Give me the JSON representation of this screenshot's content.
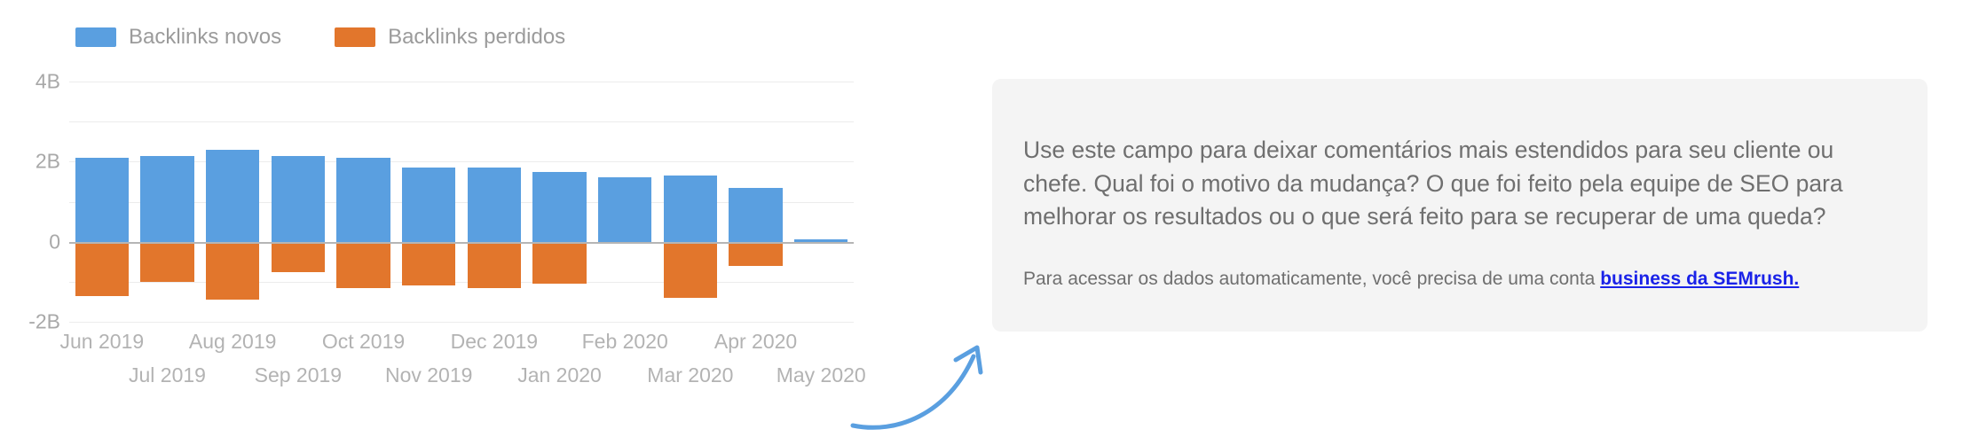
{
  "legend": {
    "items": [
      {
        "label": "Backlinks novos",
        "color": "#5a9fe0"
      },
      {
        "label": "Backlinks perdidos",
        "color": "#e2762c"
      }
    ]
  },
  "chart_data": {
    "type": "bar",
    "title": "",
    "xlabel": "",
    "ylabel": "",
    "ylim": [
      -2,
      4
    ],
    "unit": "B",
    "grid": true,
    "legend_position": "top-left",
    "gridline_values": [
      4,
      3,
      2,
      1,
      0,
      -1,
      -2
    ],
    "ytick_labels": [
      "4B",
      "2B",
      "0",
      "-2B"
    ],
    "ytick_values": [
      4,
      2,
      0,
      -2
    ],
    "categories": [
      "Jun 2019",
      "Jul 2019",
      "Aug 2019",
      "Sep 2019",
      "Oct 2019",
      "Nov 2019",
      "Dec 2019",
      "Jan 2020",
      "Feb 2020",
      "Mar 2020",
      "Apr 2020",
      "May 2020"
    ],
    "series": [
      {
        "name": "Backlinks novos",
        "color": "#5a9fe0",
        "values": [
          2.1,
          2.15,
          2.3,
          2.15,
          2.1,
          1.85,
          1.85,
          1.75,
          1.6,
          1.65,
          1.35,
          0.05
        ]
      },
      {
        "name": "Backlinks perdidos",
        "color": "#e2762c",
        "values": [
          -1.35,
          -1.0,
          -1.45,
          -0.75,
          -1.15,
          -1.1,
          -1.15,
          -1.05,
          -0.05,
          -1.4,
          -0.6,
          -0.03
        ]
      }
    ]
  },
  "arrow": {
    "color": "#5a9fe0"
  },
  "comment": {
    "main": "Use este campo para deixar comentários mais estendidos para seu cliente ou chefe. Qual foi o motivo da mudança? O que foi feito pela equipe de SEO para melhorar os resultados ou o que será feito para se recuperar de uma queda?",
    "note_prefix": "Para acessar os dados automaticamente, você precisa de uma conta ",
    "link_text": "business da SEMrush.",
    "link_color": "#1a22e8",
    "background": "#f4f4f4"
  }
}
